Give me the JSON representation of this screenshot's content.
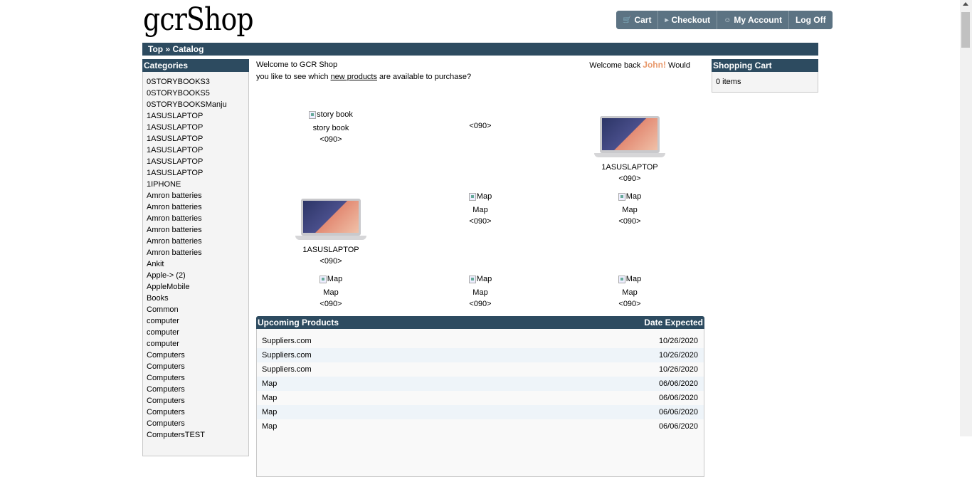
{
  "header": {
    "logo": "gcrShop"
  },
  "nav": [
    {
      "label": "Cart",
      "icon": "cart-icon"
    },
    {
      "label": "Checkout",
      "icon": "arrow-right-icon"
    },
    {
      "label": "My Account",
      "icon": "user-icon"
    },
    {
      "label": "Log Off"
    }
  ],
  "breadcrumb": {
    "top": "Top",
    "sep": " » ",
    "catalog": "Catalog"
  },
  "categories": {
    "title": "Categories",
    "items": [
      "0STORYBOOKS3",
      "0STORYBOOKS5",
      "0STORYBOOKSManju",
      "1ASUSLAPTOP",
      "1ASUSLAPTOP",
      "1ASUSLAPTOP",
      "1ASUSLAPTOP",
      "1ASUSLAPTOP",
      "1ASUSLAPTOP",
      "1IPHONE",
      "Amron batteries",
      "Amron batteries",
      "Amron batteries",
      "Amron batteries",
      "Amron batteries",
      "Amron batteries",
      "Ankit",
      "Apple-> (2)",
      "AppleMobile",
      "Books",
      "Common",
      "computer",
      "computer",
      "computer",
      "Computers",
      "Computers",
      "Computers",
      "Computers",
      "Computers",
      "Computers",
      "Computers",
      "ComputersTEST"
    ]
  },
  "welcome": {
    "left": "Welcome to GCR Shop",
    "right_pre": "Welcome back ",
    "user": "John!",
    "right_post": " Would",
    "line2_pre": "you like to see which ",
    "link": "new products",
    "line2_post": " are available to purchase?"
  },
  "products": [
    {
      "name": "story book",
      "alt": "story book",
      "code": "<090>",
      "image": "broken"
    },
    {
      "name": "",
      "alt": "",
      "code": "<090>",
      "image": "none"
    },
    {
      "name": "1ASUSLAPTOP",
      "alt": "",
      "code": "<090>",
      "image": "laptop"
    },
    {
      "name": "1ASUSLAPTOP",
      "alt": "",
      "code": "<090>",
      "image": "laptop"
    },
    {
      "name": "Map",
      "alt": "Map",
      "code": "<090>",
      "image": "broken"
    },
    {
      "name": "Map",
      "alt": "Map",
      "code": "<090>",
      "image": "broken"
    },
    {
      "name": "Map",
      "alt": "Map",
      "code": "<090>",
      "image": "broken"
    },
    {
      "name": "Map",
      "alt": "Map",
      "code": "<090>",
      "image": "broken"
    },
    {
      "name": "Map",
      "alt": "Map",
      "code": "<090>",
      "image": "broken"
    }
  ],
  "upcoming": {
    "title": "Upcoming Products",
    "date_header": "Date Expected",
    "rows": [
      {
        "name": "Suppliers.com",
        "date": "10/26/2020"
      },
      {
        "name": "Suppliers.com",
        "date": "10/26/2020"
      },
      {
        "name": "Suppliers.com",
        "date": "10/26/2020"
      },
      {
        "name": "Map",
        "date": "06/06/2020"
      },
      {
        "name": "Map",
        "date": "06/06/2020"
      },
      {
        "name": "Map",
        "date": "06/06/2020"
      },
      {
        "name": "Map",
        "date": "06/06/2020"
      }
    ]
  },
  "cart": {
    "title": "Shopping Cart",
    "items": "0 items"
  },
  "colors": {
    "header_bar": "#2d4b60",
    "nav_button": "#5c7383",
    "user_highlight": "#e8996c"
  }
}
